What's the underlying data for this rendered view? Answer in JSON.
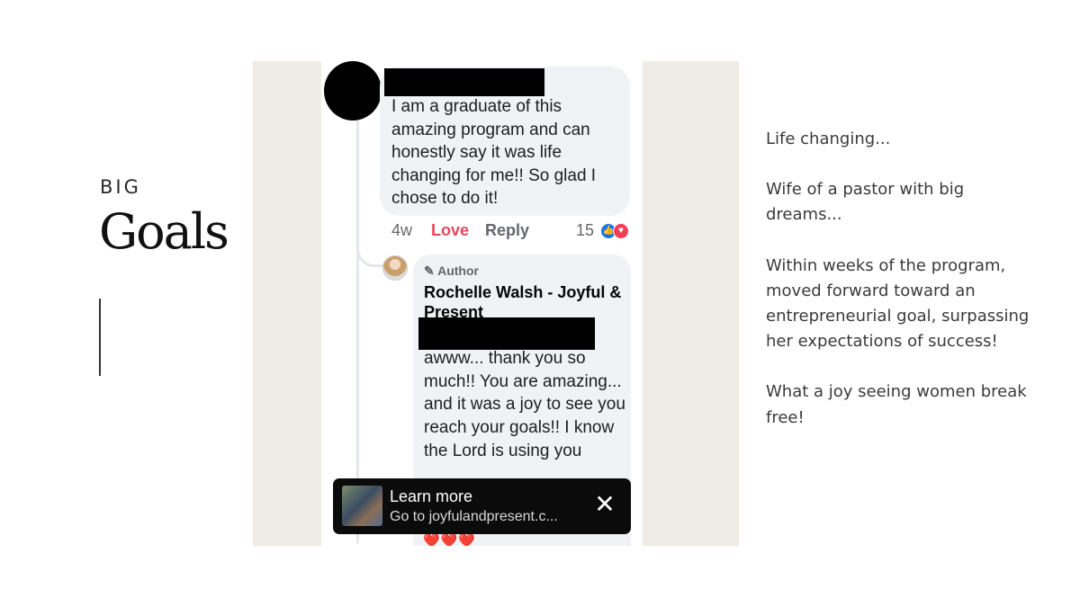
{
  "title": {
    "small": "BIG",
    "large": "Goals"
  },
  "comment1": {
    "text": "I am a graduate of this amazing program and can honestly say it was life changing for me!! So glad I chose to do it!",
    "time": "4w",
    "love_label": "Love",
    "reply_label": "Reply",
    "reaction_count": "15",
    "reactions": [
      "like-icon",
      "love-icon"
    ]
  },
  "comment2": {
    "badge": "Author",
    "author": "Rochelle Walsh - Joyful & Present",
    "text": "awww... thank you so much!!  You are amazing... and it was a joy to see you reach your goals!!  I know the Lord is using you",
    "emoji": "❤️❤️❤️"
  },
  "learn_more": {
    "title": "Learn more",
    "subtitle": "Go to joyfulandpresent.c...",
    "close": "✕"
  },
  "caption": {
    "p1": "Life changing...",
    "p2": "Wife of a pastor with big dreams...",
    "p3": "Within weeks of the program, moved forward toward an entrepreneurial goal, surpassing her expectations of success!",
    "p4": "What a joy seeing women break free!"
  }
}
